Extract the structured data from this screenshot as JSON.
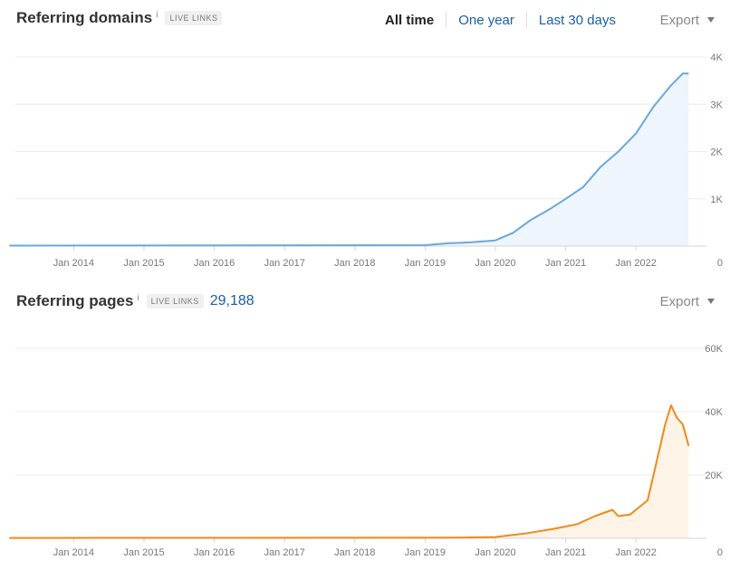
{
  "section1": {
    "title": "Referring domains",
    "info": "i",
    "badge": "LIVE LINKS",
    "tabs": [
      "All time",
      "One year",
      "Last 30 days"
    ],
    "export_label": "Export"
  },
  "section2": {
    "title": "Referring pages",
    "info": "i",
    "badge": "LIVE LINKS",
    "count": "29,188",
    "export_label": "Export"
  },
  "colors": {
    "domains": "#6aa8dc",
    "domains_fill": "#eef5fc",
    "pages": "#f0891d",
    "pages_fill": "#fef3e7"
  },
  "chart_data": [
    {
      "type": "area",
      "title": "Referring domains",
      "x_ticks": [
        "Jan 2014",
        "Jan 2015",
        "Jan 2016",
        "Jan 2017",
        "Jan 2018",
        "Jan 2019",
        "Jan 2020",
        "Jan 2021",
        "Jan 2022"
      ],
      "y_ticks": [
        "0",
        "1K",
        "2K",
        "3K",
        "4K"
      ],
      "ylim": [
        0,
        4000
      ],
      "grid": true,
      "series": [
        {
          "x": [
            "2013-02",
            "2019-01",
            "2019-05",
            "2019-09",
            "2020-01",
            "2020-04",
            "2020-07",
            "2020-10",
            "2021-01",
            "2021-04",
            "2021-07",
            "2021-10",
            "2022-01",
            "2022-04",
            "2022-07",
            "2022-09",
            "2022-10"
          ],
          "values": [
            10,
            20,
            60,
            80,
            120,
            280,
            550,
            760,
            1000,
            1250,
            1680,
            2000,
            2380,
            2950,
            3400,
            3650,
            3650
          ]
        }
      ]
    },
    {
      "type": "area",
      "title": "Referring pages",
      "x_ticks": [
        "Jan 2014",
        "Jan 2015",
        "Jan 2016",
        "Jan 2017",
        "Jan 2018",
        "Jan 2019",
        "Jan 2020",
        "Jan 2021",
        "Jan 2022"
      ],
      "y_ticks": [
        "0",
        "20K",
        "40K",
        "60K"
      ],
      "ylim": [
        0,
        60000
      ],
      "grid": true,
      "series": [
        {
          "x": [
            "2013-02",
            "2019-06",
            "2020-01",
            "2020-06",
            "2020-11",
            "2021-03",
            "2021-06",
            "2021-09",
            "2021-10",
            "2021-12",
            "2022-01",
            "2022-03",
            "2022-04",
            "2022-05",
            "2022-06",
            "2022-07",
            "2022-08",
            "2022-09",
            "2022-10"
          ],
          "values": [
            100,
            200,
            400,
            1500,
            3000,
            4500,
            7000,
            9000,
            7000,
            7500,
            9000,
            12000,
            20000,
            28000,
            36000,
            42000,
            38000,
            36000,
            29188
          ]
        }
      ]
    }
  ]
}
